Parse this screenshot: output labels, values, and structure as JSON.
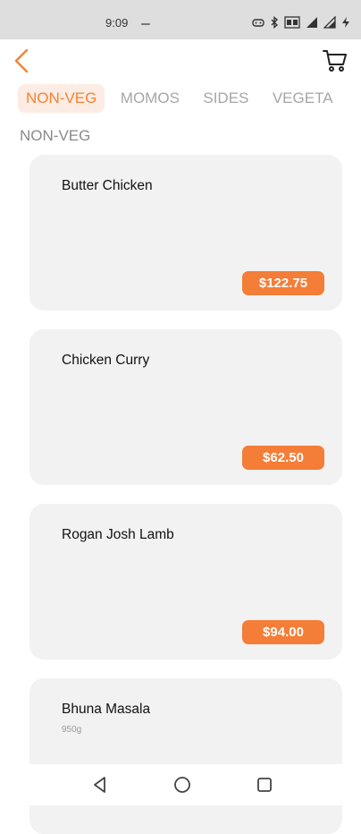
{
  "status_bar": {
    "time": "9:09",
    "icons": [
      "game-controller-icon",
      "bluetooth-icon",
      "volte-icon",
      "signal-icon",
      "signal-icon",
      "charging-icon"
    ]
  },
  "header": {
    "back_icon": "chevron-left-icon",
    "cart_icon": "cart-icon",
    "accent_color": "#f58233"
  },
  "categories": [
    {
      "label": "NON-VEG",
      "active": true
    },
    {
      "label": "MOMOS",
      "active": false
    },
    {
      "label": "SIDES",
      "active": false
    },
    {
      "label": "VEGETA",
      "active": false
    }
  ],
  "section_title": "NON-VEG",
  "items": [
    {
      "name": "Butter Chicken",
      "description": "",
      "price": "$122.75"
    },
    {
      "name": "Chicken Curry",
      "description": "",
      "price": "$62.50"
    },
    {
      "name": "Rogan Josh Lamb",
      "description": "",
      "price": "$94.00"
    },
    {
      "name": "Bhuna Masala",
      "description": "950g",
      "price": ""
    }
  ],
  "nav": {
    "back_icon": "triangle-back-icon",
    "home_icon": "circle-home-icon",
    "recents_icon": "square-recents-icon"
  },
  "colors": {
    "price_badge": "#f47d37",
    "card_bg": "#f2f2f2",
    "tab_active_bg": "#fdece3"
  }
}
